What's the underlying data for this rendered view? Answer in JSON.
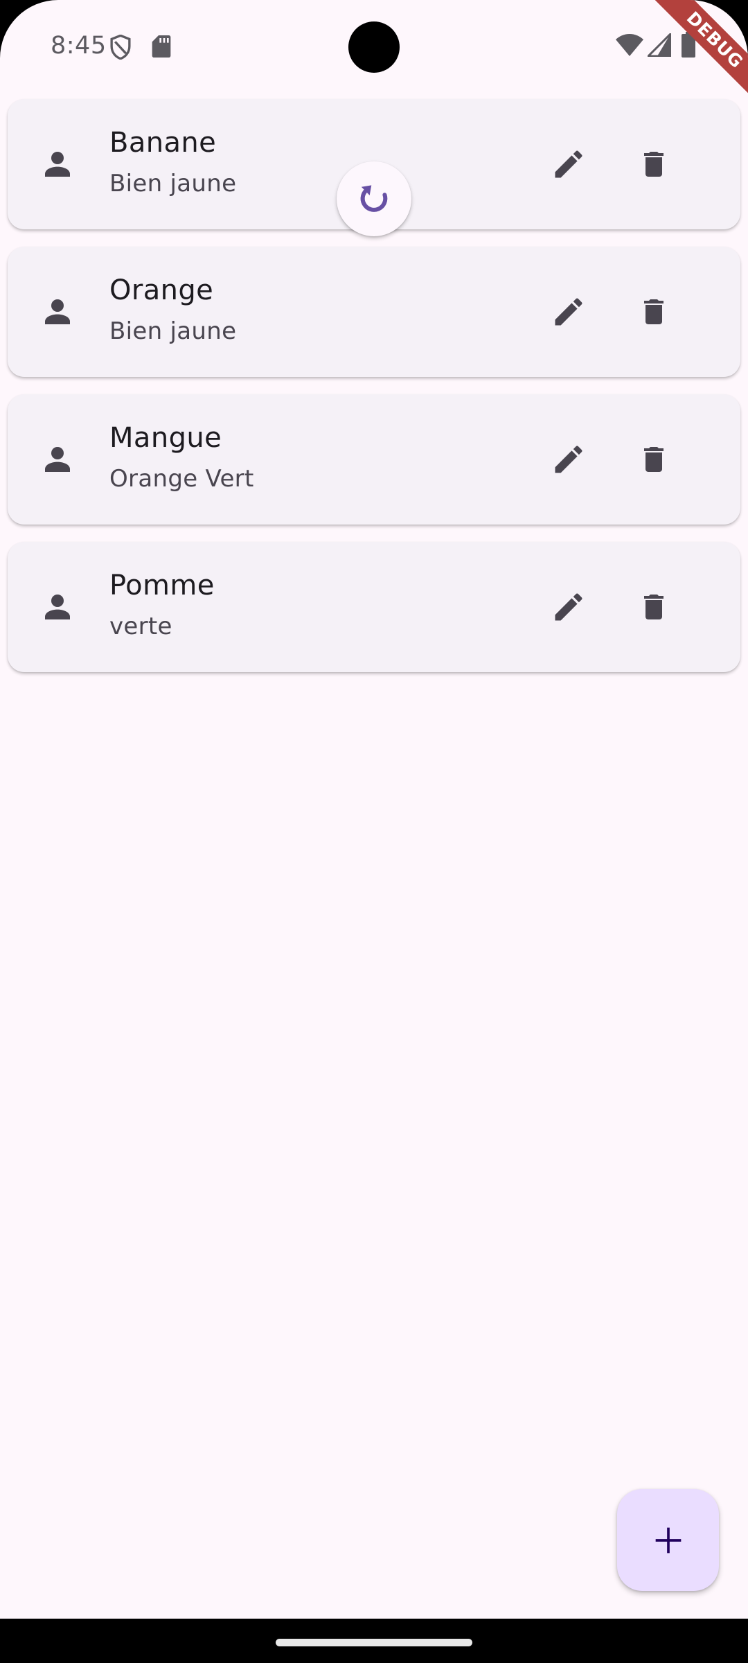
{
  "status_bar": {
    "time": "8:45",
    "icons": [
      "shield-icon",
      "sd-card-icon",
      "wifi-icon",
      "signal-icon",
      "battery-icon"
    ]
  },
  "debug_banner": "DEBUG",
  "items": [
    {
      "title": "Banane",
      "subtitle": "Bien jaune"
    },
    {
      "title": "Orange",
      "subtitle": "Bien jaune"
    },
    {
      "title": "Mangue",
      "subtitle": "Orange Vert"
    },
    {
      "title": "Pomme",
      "subtitle": "verte"
    }
  ],
  "icons": {
    "leading": "person-icon",
    "edit": "edit-icon",
    "delete": "delete-icon",
    "refresh": "refresh-icon",
    "fab": "add-icon"
  },
  "colors": {
    "background": "#fef7fc",
    "card": "#f5f1f7",
    "icon": "#49454f",
    "accent": "#6750a4",
    "fab": "#eaddff",
    "fab_icon": "#21005d",
    "debug_ribbon": "#b3413d"
  }
}
